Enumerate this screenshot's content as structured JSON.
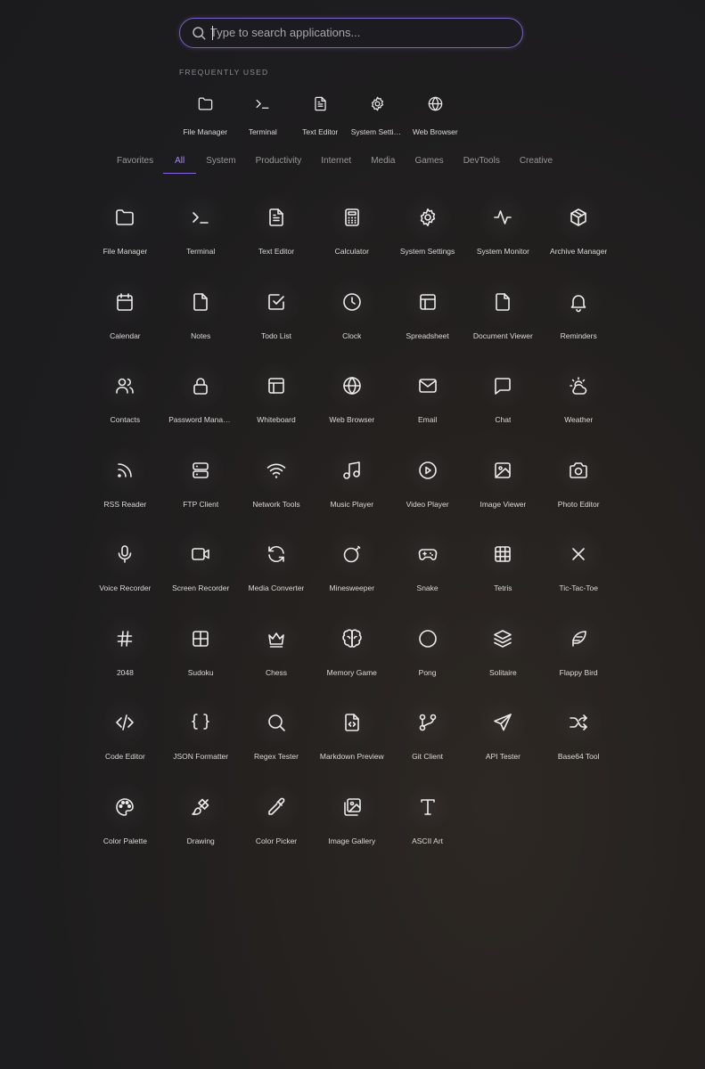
{
  "search": {
    "placeholder": "Type to search applications...",
    "value": ""
  },
  "frequent": {
    "label": "FREQUENTLY USED",
    "items": [
      {
        "label": "File Manager",
        "icon": "folder"
      },
      {
        "label": "Terminal",
        "icon": "terminal"
      },
      {
        "label": "Text Editor",
        "icon": "file-text"
      },
      {
        "label": "System Settings",
        "icon": "gear"
      },
      {
        "label": "Web Browser",
        "icon": "globe"
      }
    ]
  },
  "tabs": [
    {
      "label": "Favorites",
      "active": false
    },
    {
      "label": "All",
      "active": true
    },
    {
      "label": "System",
      "active": false
    },
    {
      "label": "Productivity",
      "active": false
    },
    {
      "label": "Internet",
      "active": false
    },
    {
      "label": "Media",
      "active": false
    },
    {
      "label": "Games",
      "active": false
    },
    {
      "label": "DevTools",
      "active": false
    },
    {
      "label": "Creative",
      "active": false
    }
  ],
  "apps": [
    {
      "label": "File Manager",
      "icon": "folder"
    },
    {
      "label": "Terminal",
      "icon": "terminal"
    },
    {
      "label": "Text Editor",
      "icon": "file-text"
    },
    {
      "label": "Calculator",
      "icon": "calculator"
    },
    {
      "label": "System Settings",
      "icon": "gear"
    },
    {
      "label": "System Monitor",
      "icon": "activity"
    },
    {
      "label": "Archive Manager",
      "icon": "package"
    },
    {
      "label": "Calendar",
      "icon": "calendar"
    },
    {
      "label": "Notes",
      "icon": "file"
    },
    {
      "label": "Todo List",
      "icon": "checkbox"
    },
    {
      "label": "Clock",
      "icon": "clock"
    },
    {
      "label": "Spreadsheet",
      "icon": "table"
    },
    {
      "label": "Document Viewer",
      "icon": "file"
    },
    {
      "label": "Reminders",
      "icon": "bell"
    },
    {
      "label": "Contacts",
      "icon": "users"
    },
    {
      "label": "Password Manager",
      "icon": "lock"
    },
    {
      "label": "Whiteboard",
      "icon": "layout"
    },
    {
      "label": "Web Browser",
      "icon": "globe"
    },
    {
      "label": "Email",
      "icon": "mail"
    },
    {
      "label": "Chat",
      "icon": "message"
    },
    {
      "label": "Weather",
      "icon": "cloud-sun"
    },
    {
      "label": "RSS Reader",
      "icon": "rss"
    },
    {
      "label": "FTP Client",
      "icon": "server"
    },
    {
      "label": "Network Tools",
      "icon": "wifi"
    },
    {
      "label": "Music Player",
      "icon": "music"
    },
    {
      "label": "Video Player",
      "icon": "play-circle"
    },
    {
      "label": "Image Viewer",
      "icon": "image"
    },
    {
      "label": "Photo Editor",
      "icon": "camera"
    },
    {
      "label": "Voice Recorder",
      "icon": "mic"
    },
    {
      "label": "Screen Recorder",
      "icon": "video"
    },
    {
      "label": "Media Converter",
      "icon": "refresh"
    },
    {
      "label": "Minesweeper",
      "icon": "bomb"
    },
    {
      "label": "Snake",
      "icon": "gamepad"
    },
    {
      "label": "Tetris",
      "icon": "grid"
    },
    {
      "label": "Tic-Tac-Toe",
      "icon": "x"
    },
    {
      "label": "2048",
      "icon": "hash"
    },
    {
      "label": "Sudoku",
      "icon": "grid-2"
    },
    {
      "label": "Chess",
      "icon": "crown"
    },
    {
      "label": "Memory Game",
      "icon": "brain"
    },
    {
      "label": "Pong",
      "icon": "circle"
    },
    {
      "label": "Solitaire",
      "icon": "layers"
    },
    {
      "label": "Flappy Bird",
      "icon": "feather"
    },
    {
      "label": "Code Editor",
      "icon": "code"
    },
    {
      "label": "JSON Formatter",
      "icon": "braces"
    },
    {
      "label": "Regex Tester",
      "icon": "search"
    },
    {
      "label": "Markdown Preview",
      "icon": "file-code"
    },
    {
      "label": "Git Client",
      "icon": "git-branch"
    },
    {
      "label": "API Tester",
      "icon": "send"
    },
    {
      "label": "Base64 Tool",
      "icon": "shuffle"
    },
    {
      "label": "Color Palette",
      "icon": "palette"
    },
    {
      "label": "Drawing",
      "icon": "brush"
    },
    {
      "label": "Color Picker",
      "icon": "pipette"
    },
    {
      "label": "Image Gallery",
      "icon": "images"
    },
    {
      "label": "ASCII Art",
      "icon": "type"
    }
  ]
}
